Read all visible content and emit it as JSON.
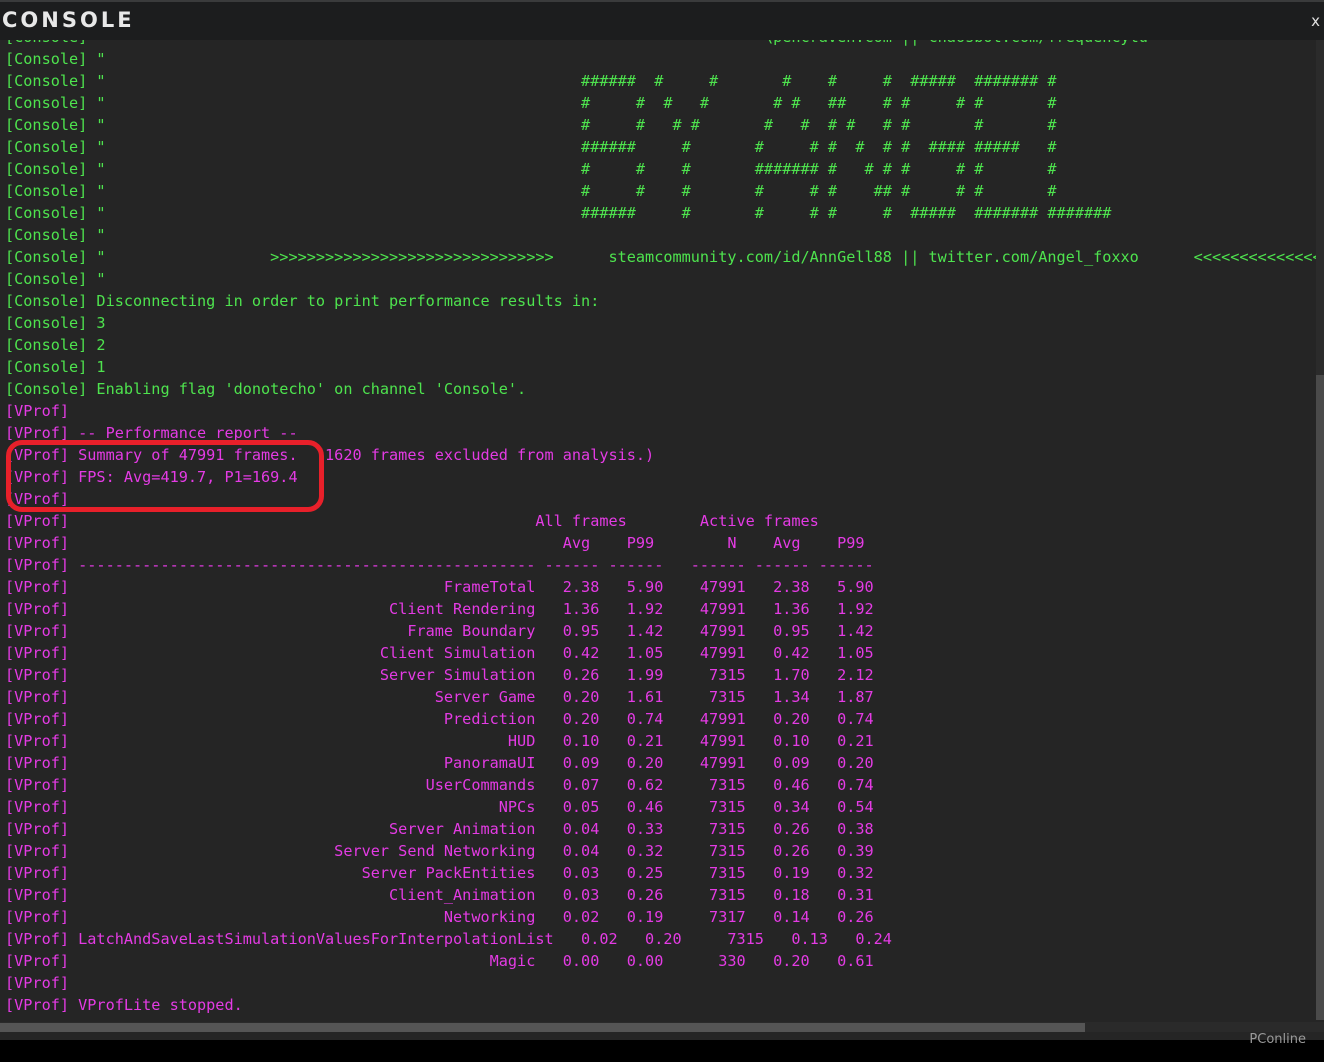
{
  "window": {
    "title": "CONSOLE",
    "close_label": "x"
  },
  "lines": [
    {
      "k": "c",
      "t": "[Console] \"                                                                        \\pencraven.com || chaosbot.com/frequencytu"
    },
    {
      "k": "c",
      "t": "[Console] \""
    },
    {
      "k": "c",
      "t": "[Console] \"                                                    ######  #     #       #    #     #  #####  ####### #"
    },
    {
      "k": "c",
      "t": "[Console] \"                                                    #     #  #   #       # #   ##    # #     # #       #"
    },
    {
      "k": "c",
      "t": "[Console] \"                                                    #     #   # #       #   #  # #   # #       #       #"
    },
    {
      "k": "c",
      "t": "[Console] \"                                                    ######     #       #     # #  #  # #  #### #####   #"
    },
    {
      "k": "c",
      "t": "[Console] \"                                                    #     #    #       ####### #   # # #     # #       #"
    },
    {
      "k": "c",
      "t": "[Console] \"                                                    #     #    #       #     # #    ## #     # #       #"
    },
    {
      "k": "c",
      "t": "[Console] \"                                                    ######     #       #     # #     #  #####  ####### #######"
    },
    {
      "k": "c",
      "t": "[Console] \""
    },
    {
      "k": "c",
      "t": "[Console] \"                  >>>>>>>>>>>>>>>>>>>>>>>>>>>>>>>      steamcommunity.com/id/AnnGell88 || twitter.com/Angel_foxxo      <<<<<<<<<<<<<<<<<<<<<<<<<<<<<<<"
    },
    {
      "k": "c",
      "t": "[Console] \""
    },
    {
      "k": "c",
      "t": "[Console] Disconnecting in order to print performance results in:"
    },
    {
      "k": "c",
      "t": "[Console] 3"
    },
    {
      "k": "c",
      "t": "[Console] 2"
    },
    {
      "k": "c",
      "t": "[Console] 1"
    },
    {
      "k": "c",
      "t": "[Console] Enabling flag 'donotecho' on channel 'Console'."
    },
    {
      "k": "v",
      "t": "[VProf]"
    },
    {
      "k": "v",
      "t": "[VProf] -- Performance report --"
    },
    {
      "k": "v",
      "t": "[VProf] Summary of 47991 frames.  (1620 frames excluded from analysis.)"
    },
    {
      "k": "v",
      "t": "[VProf] FPS: Avg=419.7, P1=169.4"
    },
    {
      "k": "v",
      "t": "[VProf]"
    },
    {
      "k": "v",
      "t": "[VProf]                                                   All frames        Active frames"
    },
    {
      "k": "v",
      "t": "[VProf]                                                      Avg    P99        N    Avg    P99"
    },
    {
      "k": "v",
      "t": "[VProf] -------------------------------------------------- ------ ------   ------ ------ ------"
    },
    {
      "k": "v",
      "t": "[VProf]                                         FrameTotal   2.38   5.90    47991   2.38   5.90"
    },
    {
      "k": "v",
      "t": "[VProf]                                   Client Rendering   1.36   1.92    47991   1.36   1.92"
    },
    {
      "k": "v",
      "t": "[VProf]                                     Frame Boundary   0.95   1.42    47991   0.95   1.42"
    },
    {
      "k": "v",
      "t": "[VProf]                                  Client Simulation   0.42   1.05    47991   0.42   1.05"
    },
    {
      "k": "v",
      "t": "[VProf]                                  Server Simulation   0.26   1.99     7315   1.70   2.12"
    },
    {
      "k": "v",
      "t": "[VProf]                                        Server Game   0.20   1.61     7315   1.34   1.87"
    },
    {
      "k": "v",
      "t": "[VProf]                                         Prediction   0.20   0.74    47991   0.20   0.74"
    },
    {
      "k": "v",
      "t": "[VProf]                                                HUD   0.10   0.21    47991   0.10   0.21"
    },
    {
      "k": "v",
      "t": "[VProf]                                         PanoramaUI   0.09   0.20    47991   0.09   0.20"
    },
    {
      "k": "v",
      "t": "[VProf]                                       UserCommands   0.07   0.62     7315   0.46   0.74"
    },
    {
      "k": "v",
      "t": "[VProf]                                               NPCs   0.05   0.46     7315   0.34   0.54"
    },
    {
      "k": "v",
      "t": "[VProf]                                   Server Animation   0.04   0.33     7315   0.26   0.38"
    },
    {
      "k": "v",
      "t": "[VProf]                             Server Send Networking   0.04   0.32     7315   0.26   0.39"
    },
    {
      "k": "v",
      "t": "[VProf]                                Server PackEntities   0.03   0.25     7315   0.19   0.32"
    },
    {
      "k": "v",
      "t": "[VProf]                                   Client_Animation   0.03   0.26     7315   0.18   0.31"
    },
    {
      "k": "v",
      "t": "[VProf]                                         Networking   0.02   0.19     7317   0.14   0.26"
    },
    {
      "k": "v",
      "t": "[VProf] LatchAndSaveLastSimulationValuesForInterpolationList   0.02   0.20     7315   0.13   0.24"
    },
    {
      "k": "v",
      "t": "[VProf]                                              Magic   0.00   0.00      330   0.20   0.61"
    },
    {
      "k": "v",
      "t": "[VProf]"
    },
    {
      "k": "v",
      "t": "[VProf] VProfLite stopped."
    }
  ],
  "colors": {
    "console_text": "#4ee34e",
    "vprof_text": "#e43be4",
    "highlight": "#e8202a",
    "background": "#252525"
  },
  "watermark": "PConline"
}
